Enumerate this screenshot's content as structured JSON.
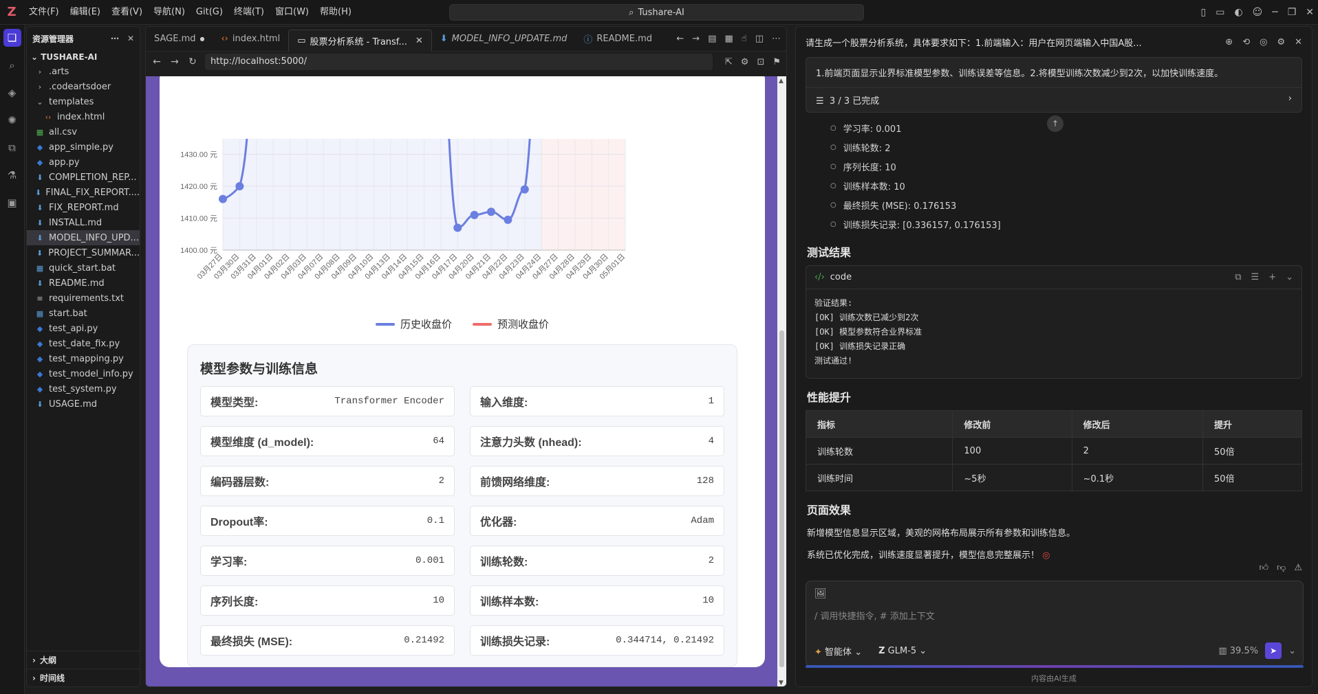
{
  "titlebar": {
    "menu": [
      "文件(F)",
      "编辑(E)",
      "查看(V)",
      "导航(N)",
      "Git(G)",
      "终端(T)",
      "窗口(W)",
      "帮助(H)"
    ],
    "search": "Tushare-AI"
  },
  "explorer": {
    "title": "资源管理器",
    "root": "TUSHARE-AI",
    "items": [
      {
        "label": ".arts",
        "icon": "chevron-right",
        "indent": 1
      },
      {
        "label": ".codeartsdoer",
        "icon": "chevron-right",
        "indent": 1
      },
      {
        "label": "templates",
        "icon": "chevron-down",
        "indent": 1
      },
      {
        "label": "index.html",
        "icon": "html",
        "indent": 2
      },
      {
        "label": "all.csv",
        "icon": "csv",
        "indent": 1
      },
      {
        "label": "app_simple.py",
        "icon": "python",
        "indent": 1
      },
      {
        "label": "app.py",
        "icon": "python",
        "indent": 1
      },
      {
        "label": "COMPLETION_REP...",
        "icon": "markdown",
        "indent": 1
      },
      {
        "label": "FINAL_FIX_REPORT....",
        "icon": "markdown",
        "indent": 1
      },
      {
        "label": "FIX_REPORT.md",
        "icon": "markdown",
        "indent": 1
      },
      {
        "label": "INSTALL.md",
        "icon": "markdown",
        "indent": 1
      },
      {
        "label": "MODEL_INFO_UPD...",
        "icon": "markdown",
        "indent": 1,
        "selected": true
      },
      {
        "label": "PROJECT_SUMMAR...",
        "icon": "markdown",
        "indent": 1
      },
      {
        "label": "quick_start.bat",
        "icon": "bat",
        "indent": 1
      },
      {
        "label": "README.md",
        "icon": "markdown",
        "indent": 1
      },
      {
        "label": "requirements.txt",
        "icon": "text",
        "indent": 1
      },
      {
        "label": "start.bat",
        "icon": "bat",
        "indent": 1
      },
      {
        "label": "test_api.py",
        "icon": "python",
        "indent": 1
      },
      {
        "label": "test_date_fix.py",
        "icon": "python",
        "indent": 1
      },
      {
        "label": "test_mapping.py",
        "icon": "python",
        "indent": 1
      },
      {
        "label": "test_model_info.py",
        "icon": "python",
        "indent": 1
      },
      {
        "label": "test_system.py",
        "icon": "python",
        "indent": 1
      },
      {
        "label": "USAGE.md",
        "icon": "markdown",
        "indent": 1
      }
    ],
    "outline": "大纲",
    "timeline": "时间线"
  },
  "tabs": [
    {
      "label": "SAGE.md",
      "dot": true
    },
    {
      "label": "index.html",
      "icon": "html"
    },
    {
      "label": "股票分析系统 - Transf...",
      "active": true
    },
    {
      "label": "MODEL_INFO_UPDATE.md",
      "italic": true
    },
    {
      "label": "README.md",
      "icon": "info"
    }
  ],
  "browser": {
    "url": "http://localhost:5000/"
  },
  "chart_data": {
    "type": "line",
    "x": [
      "03月27日",
      "03月30日",
      "03月31日",
      "04月01日",
      "04月02日",
      "04月03日",
      "04月07日",
      "04月08日",
      "04月09日",
      "04月10日",
      "04月13日",
      "04月14日",
      "04月15日",
      "04月16日",
      "04月17日",
      "04月20日",
      "04月21日",
      "04月22日",
      "04月23日",
      "04月24日",
      "04月27日",
      "04月28日",
      "04月29日",
      "04月30日",
      "05月01日"
    ],
    "y_ticks": [
      "1430.00 元",
      "1420.00 元",
      "1410.00 元",
      "1400.00 元"
    ],
    "ylim": [
      1400,
      1437
    ],
    "series": [
      {
        "name": "历史收盘价",
        "color": "#6b7fe0",
        "points": [
          [
            0,
            1416
          ],
          [
            1,
            1420
          ],
          [
            14,
            1407
          ],
          [
            15,
            1411
          ],
          [
            16,
            1412
          ],
          [
            17,
            1409.5
          ],
          [
            18,
            1419
          ]
        ]
      },
      {
        "name": "预测收盘价",
        "color": "#f06b6b",
        "points": []
      }
    ],
    "forecast_start_index": 19,
    "grid": true,
    "legend": "bottom"
  },
  "params": {
    "title": "模型参数与训练信息",
    "rows": [
      {
        "k": "模型类型:",
        "v": "Transformer Encoder"
      },
      {
        "k": "输入维度:",
        "v": "1"
      },
      {
        "k": "模型维度 (d_model):",
        "v": "64"
      },
      {
        "k": "注意力头数 (nhead):",
        "v": "4"
      },
      {
        "k": "编码器层数:",
        "v": "2"
      },
      {
        "k": "前馈网络维度:",
        "v": "128"
      },
      {
        "k": "Dropout率:",
        "v": "0.1"
      },
      {
        "k": "优化器:",
        "v": "Adam"
      },
      {
        "k": "学习率:",
        "v": "0.001"
      },
      {
        "k": "训练轮数:",
        "v": "2"
      },
      {
        "k": "序列长度:",
        "v": "10"
      },
      {
        "k": "训练样本数:",
        "v": "10"
      },
      {
        "k": "最终损失 (MSE):",
        "v": "0.21492"
      },
      {
        "k": "训练损失记录:",
        "v": "0.344714, 0.21492"
      }
    ]
  },
  "chat": {
    "header": "请生成一个股票分析系统，具体要求如下：1.前端输入：用户在网页端输入中国A股...",
    "summary": "1.前端页面显示业界标准模型参数、训练误差等信息。2.将模型训练次数减少到2次，以加快训练速度。",
    "progress": "3 / 3 已完成",
    "bullets": [
      "学习率: 0.001",
      "训练轮数: 2",
      "序列长度: 10",
      "训练样本数: 10",
      "最终损失 (MSE): 0.176153",
      "训练损失记录: [0.336157, 0.176153]"
    ],
    "test_title": "测试结果",
    "code_label": "code",
    "code": "验证结果:\n[OK] 训练次数已减少到2次\n[OK] 模型参数符合业界标准\n[OK] 训练损失记录正确\n测试通过!",
    "perf_title": "性能提升",
    "perf_headers": [
      "指标",
      "修改前",
      "修改后",
      "提升"
    ],
    "perf_rows": [
      [
        "训练轮数",
        "100",
        "2",
        "50倍"
      ],
      [
        "训练时间",
        "~5秒",
        "~0.1秒",
        "50倍"
      ]
    ],
    "effect_title": "页面效果",
    "effect_p1": "新增模型信息显示区域，美观的网格布局展示所有参数和训练信息。",
    "effect_p2": "系统已优化完成，训练速度显著提升，模型信息完整展示！",
    "input_placeholder": "/ 调用快捷指令, # 添加上下文",
    "agent": "智能体",
    "model": "GLM-5",
    "context_pct": "39.5%",
    "footer": "内容由AI生成"
  }
}
